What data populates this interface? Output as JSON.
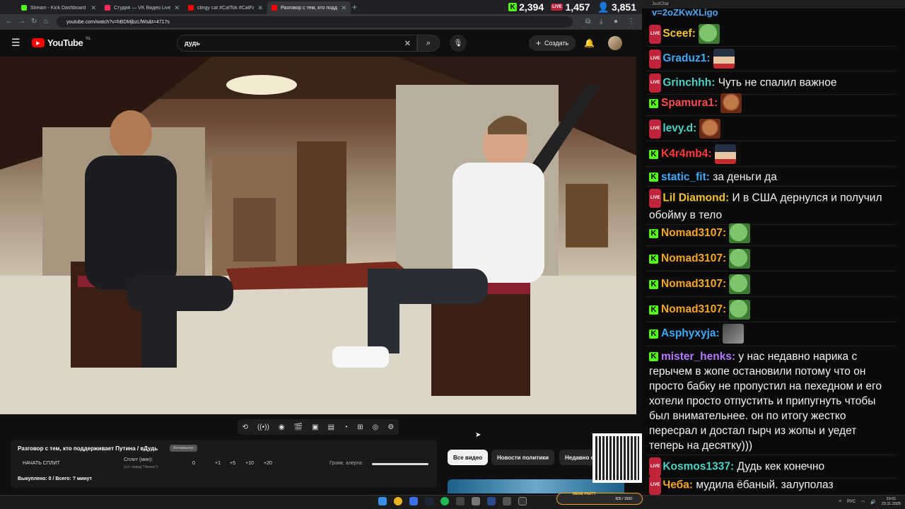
{
  "tabs": [
    {
      "title": "Stream - Kick Dashboard",
      "color": "#53fc18",
      "active": false
    },
    {
      "title": "Студия — VK Видео Live",
      "color": "#ff2a55",
      "active": false
    },
    {
      "title": "clingy cat #CatTok #CatFails20…",
      "color": "#ff0000",
      "active": false
    },
    {
      "title": "Разговор с тем, кто подде…",
      "color": "#ff0000",
      "active": true
    }
  ],
  "counters": {
    "kick": "2,394",
    "live": "1,457",
    "viewers": "3,851",
    "live_badge": "LIVE"
  },
  "browser": {
    "url": "youtube.com/watch?v=hBDMjbzLfWs&t=4717s"
  },
  "youtube": {
    "logo": "YouTube",
    "region": "NL",
    "search_value": "дудь",
    "create_label": "Создать"
  },
  "stream_panel": {
    "title": "Разговор с тем, кто поддерживает Путина / вДудь",
    "badge": "Интервьюер",
    "start_split": "НАЧАТЬ СПЛИТ",
    "split_label": "Сплит (мин):",
    "split_sub": "(уст. перед \"Начать\")",
    "value": "0",
    "buttons": [
      "+1",
      "+5",
      "+10",
      "+20"
    ],
    "volume_label": "Громк. алерта:",
    "bought": "Выкуплено: 0 / Всего: ? минут"
  },
  "chips": [
    "Все видео",
    "Новости политики",
    "Недавно о"
  ],
  "chat": {
    "title_partial": "v=2oZKwXLigo",
    "window_title": "JuulChat",
    "messages": [
      {
        "platform": "live",
        "user": "Sceef:",
        "color": "#f2c230",
        "text": "",
        "emote": "pepe"
      },
      {
        "platform": "live",
        "user": "Graduz1:",
        "color": "#3fa9f5",
        "text": "",
        "emote": "cap"
      },
      {
        "platform": "live",
        "user": "Grinchhh:",
        "color": "#4fd1c5",
        "text": "Чуть не спалил важное",
        "emote": ""
      },
      {
        "platform": "kick",
        "user": "Spamura1:",
        "color": "#ff4d4d",
        "text": "",
        "emote": "face"
      },
      {
        "platform": "live",
        "user": "levy.d:",
        "color": "#4fd1c5",
        "text": "",
        "emote": "face"
      },
      {
        "platform": "kick",
        "user": "K4r4mb4:",
        "color": "#ff3b3b",
        "text": "",
        "emote": "cap"
      },
      {
        "platform": "kick",
        "user": "static_fit:",
        "color": "#3fa9f5",
        "text": "за деньги да",
        "emote": ""
      },
      {
        "platform": "live",
        "user": "Lil Diamond:",
        "color": "#f2c230",
        "text": "И в США дернулся и получил обойму в тело",
        "emote": ""
      },
      {
        "platform": "kick",
        "user": "Nomad3107:",
        "color": "#f5a623",
        "text": "",
        "emote": "pepe"
      },
      {
        "platform": "kick",
        "user": "Nomad3107:",
        "color": "#f5a623",
        "text": "",
        "emote": "pepe"
      },
      {
        "platform": "kick",
        "user": "Nomad3107:",
        "color": "#f5a623",
        "text": "",
        "emote": "pepe"
      },
      {
        "platform": "kick",
        "user": "Nomad3107:",
        "color": "#f5a623",
        "text": "",
        "emote": "pepe"
      },
      {
        "platform": "kick",
        "user": "Asphyxyja:",
        "color": "#3fa9f5",
        "text": "",
        "emote": "cat"
      },
      {
        "platform": "kick",
        "user": "mister_henks:",
        "color": "#b57bff",
        "text": "у нас недавно нарика с герычем в жопе остановили потому что он просто бабку не пропустил на пехедном и его хотели просто отпустить и припугнуть чтобы был внимательнее. он по итогу жестко пересрал и достал гырч из жопы и уедет теперь на десятку)))",
        "emote": ""
      },
      {
        "platform": "live",
        "user": "Kosmos1337:",
        "color": "#4fd1c5",
        "text": "Дудь кек конечно",
        "emote": ""
      },
      {
        "platform": "live",
        "user": "Чеба:",
        "color": "#f5a623",
        "text": "мудила ёбаный. залуполаз",
        "emote": ""
      }
    ]
  },
  "taskbar": {
    "lang": "РУС",
    "time": "19:01",
    "date": "23.11.2025",
    "meme_label": "MEME PARTY",
    "meme_value": "925 / 1500"
  },
  "colors": {
    "kick_green": "#53fc18",
    "live_red": "#c0243b",
    "yt_red": "#ff0000"
  }
}
